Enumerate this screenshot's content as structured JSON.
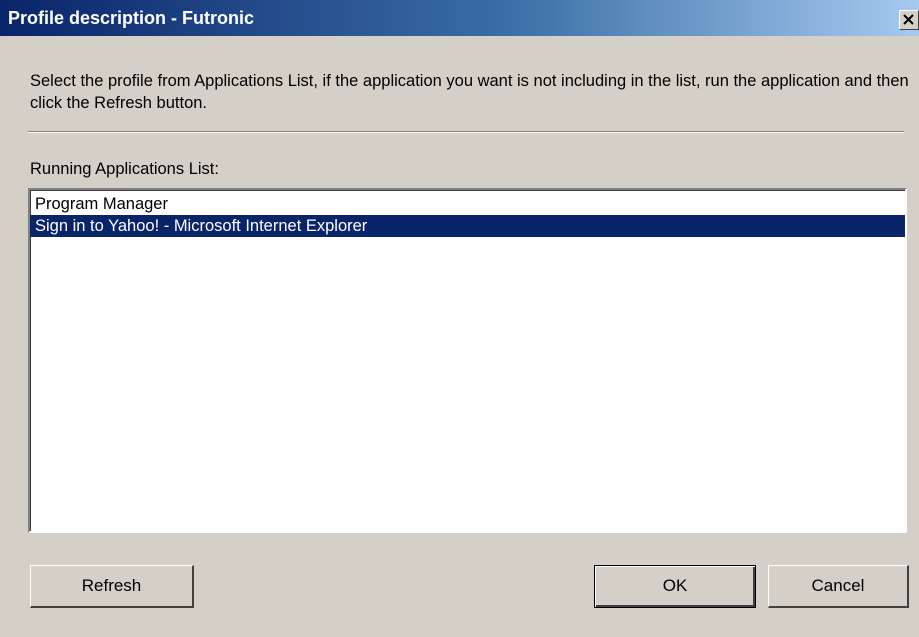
{
  "window": {
    "title": "Profile description - Futronic"
  },
  "titlebar": {
    "close_icon": "close-icon"
  },
  "instructions": {
    "text": "Select the profile from Applications List, if the application you want is not including in the list, run the application and then click the Refresh button."
  },
  "list": {
    "label": "Running Applications List:",
    "items": [
      {
        "label": "Program Manager",
        "selected": false
      },
      {
        "label": "Sign in to Yahoo! - Microsoft Internet Explorer",
        "selected": true
      }
    ]
  },
  "buttons": {
    "refresh_label": "Refresh",
    "ok_label": "OK",
    "cancel_label": "Cancel"
  },
  "colors": {
    "titlebar_start": "#0a246a",
    "titlebar_end": "#a6caf0",
    "face": "#d4d0c8",
    "selection": "#0a246a"
  }
}
